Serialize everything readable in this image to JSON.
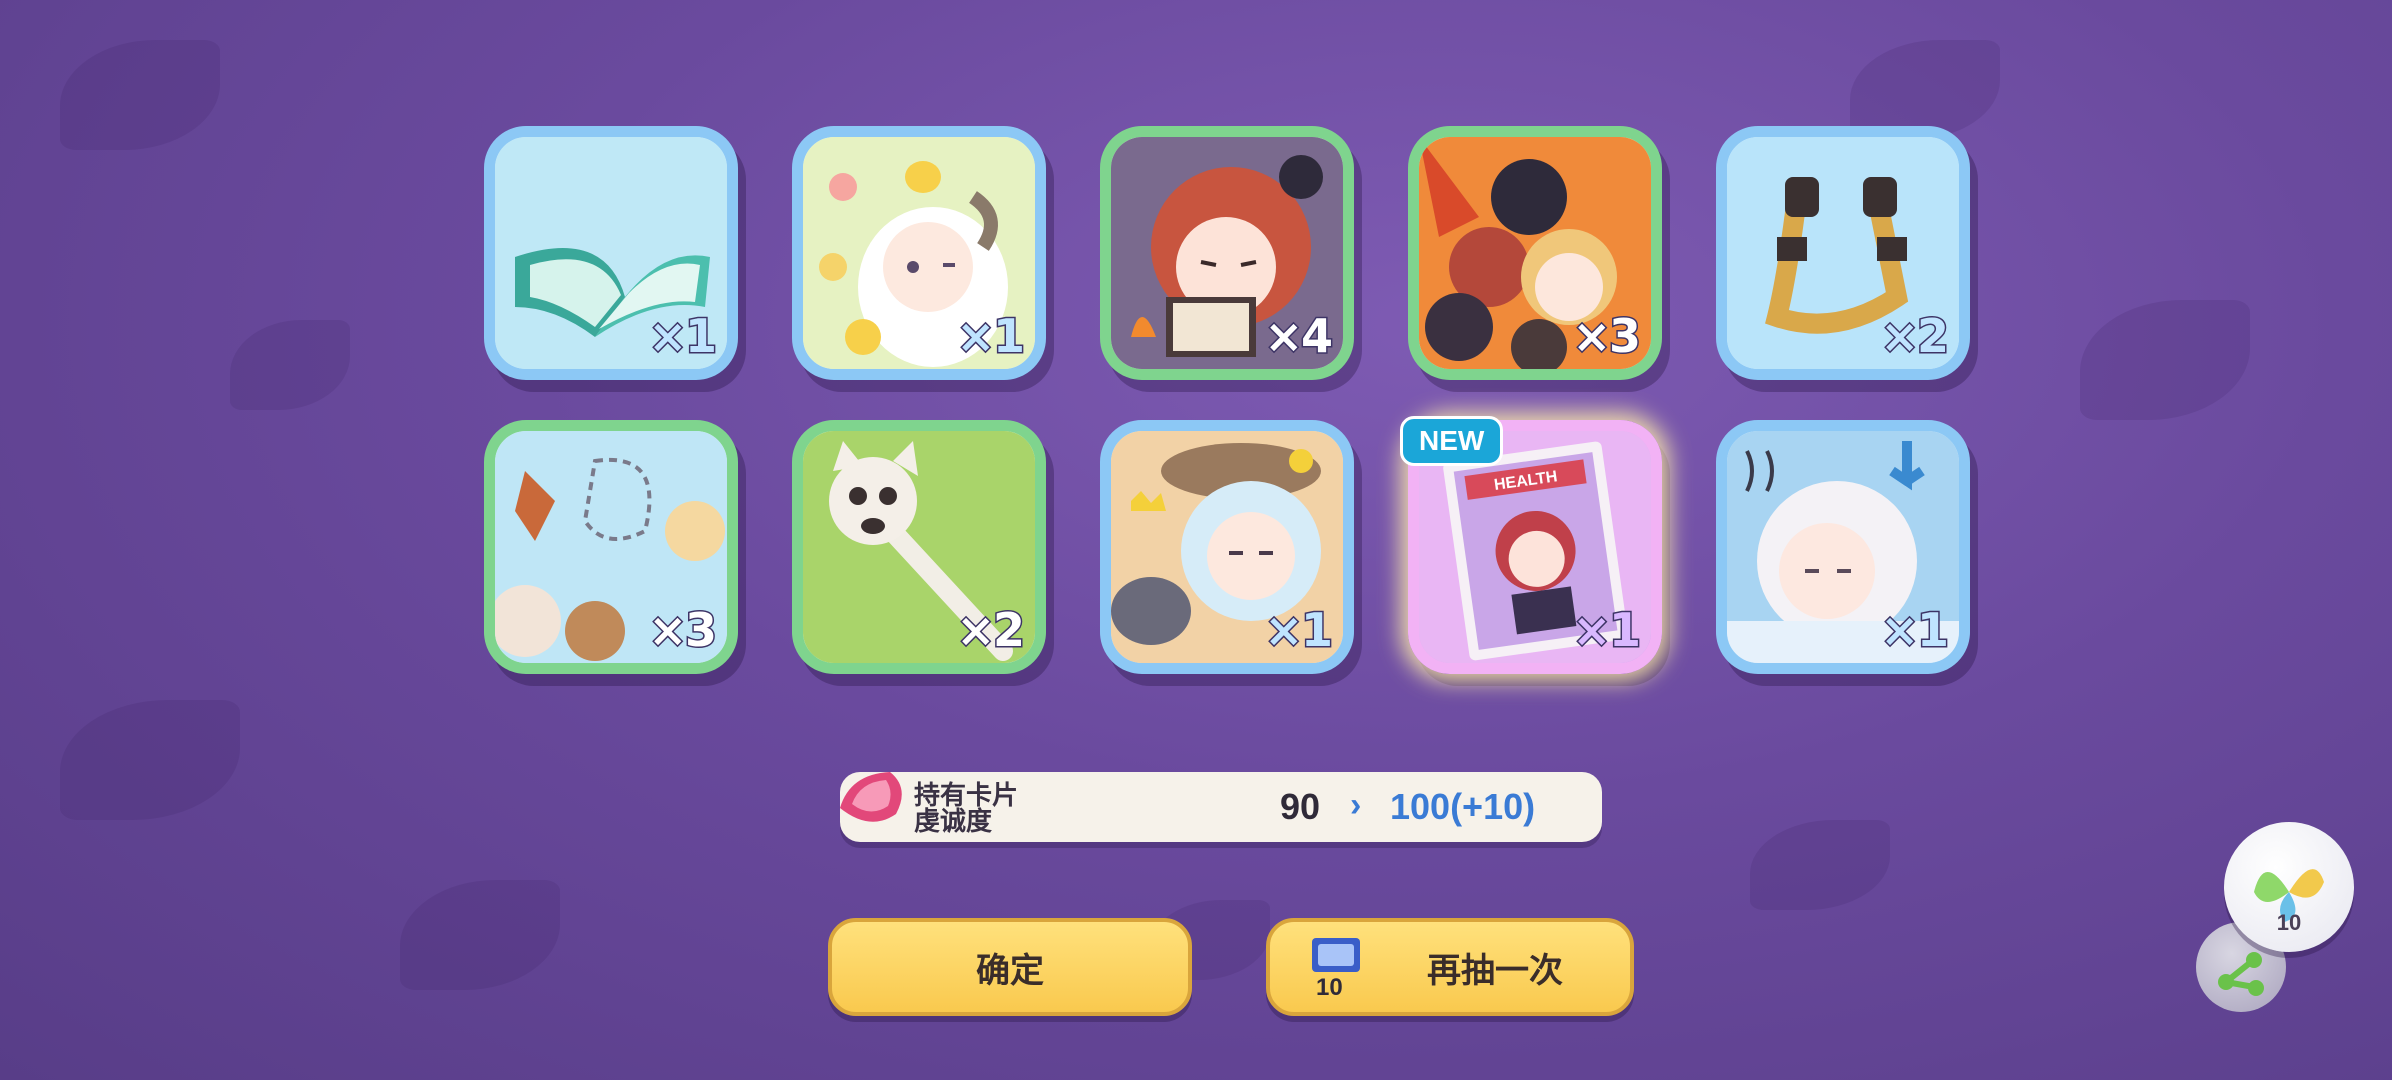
{
  "cards": [
    {
      "id": "book",
      "frame": "blue",
      "qty": "×1"
    },
    {
      "id": "sheep-girl",
      "frame": "blue",
      "qty": "×1"
    },
    {
      "id": "reading-girl",
      "frame": "green",
      "qty": "×4"
    },
    {
      "id": "group-fire",
      "frame": "green",
      "qty": "×3"
    },
    {
      "id": "straps",
      "frame": "blue",
      "qty": "×2"
    },
    {
      "id": "chase",
      "frame": "green",
      "qty": "×3"
    },
    {
      "id": "cat-staff",
      "frame": "green",
      "qty": "×2"
    },
    {
      "id": "silver-girl",
      "frame": "blue",
      "qty": "×1"
    },
    {
      "id": "health-magazine",
      "frame": "pink",
      "qty": "×1",
      "badge": "NEW",
      "art_text": "HEALTH"
    },
    {
      "id": "sleepy-girl",
      "frame": "blue",
      "qty": "×1"
    }
  ],
  "loyalty": {
    "label_line1": "持有卡片",
    "label_line2": "虔诚度",
    "current": "90",
    "arrow": "›",
    "next": "100(+10)"
  },
  "buttons": {
    "confirm": "确定",
    "again": "再抽一次",
    "ticket_count": "10"
  },
  "fab": {
    "count": "10"
  },
  "colors": {
    "button": "#f9c94e",
    "accent_blue": "#3a7bd5"
  }
}
